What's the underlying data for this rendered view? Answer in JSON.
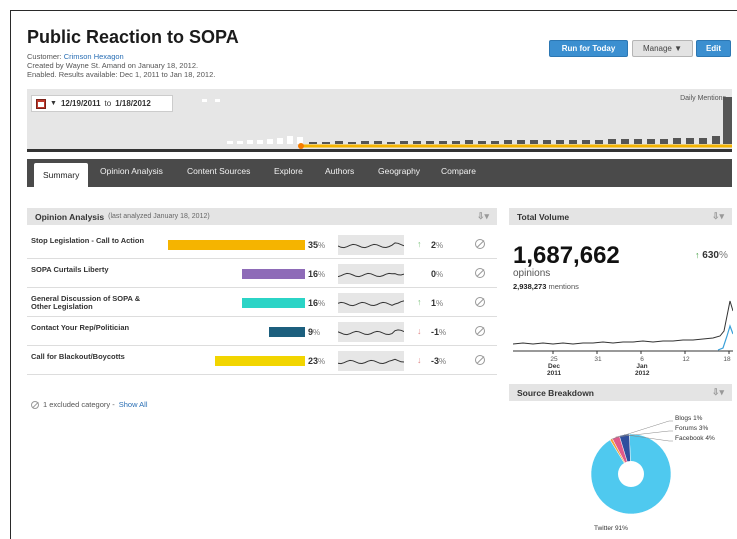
{
  "header": {
    "title": "Public Reaction to SOPA",
    "customer_prefix": "Customer:",
    "customer_name": "Crimson Hexagon",
    "created_line": "Created by Wayne St. Amand on January 18, 2012.",
    "enabled_line": "Enabled. Results available: Dec 1, 2011 to Jan 18, 2012."
  },
  "toolbar": {
    "run_label": "Run for Today",
    "manage_label": "Manage ▼",
    "edit_label": "Edit"
  },
  "timeline": {
    "date_from": "12/19/2011",
    "date_to_word": "to",
    "date_to": "1/18/2012",
    "daily_label": "Daily Mentions",
    "accent_color": "#f5b400"
  },
  "tabs": [
    {
      "label": "Summary"
    },
    {
      "label": "Opinion Analysis"
    },
    {
      "label": "Content Sources"
    },
    {
      "label": "Explore"
    },
    {
      "label": "Authors"
    },
    {
      "label": "Geography"
    },
    {
      "label": "Compare"
    }
  ],
  "opinion_panel": {
    "title": "Opinion Analysis",
    "subtitle": "(last analyzed January 18, 2012)",
    "rows": [
      {
        "label": "Stop Legislation - Call to Action",
        "pct": "35",
        "bar_fraction": 1.0,
        "color": "#f5b400",
        "change": "2",
        "direction": "up",
        "arrow": "↑"
      },
      {
        "label": "SOPA Curtails Liberty",
        "pct": "16",
        "bar_fraction": 0.46,
        "color": "#8e6bb8",
        "change": "0",
        "direction": "none",
        "arrow": ""
      },
      {
        "label": "General Discussion of SOPA & Other Legislation",
        "pct": "16",
        "bar_fraction": 0.46,
        "color": "#2bd4c6",
        "change": "1",
        "direction": "up",
        "arrow": "↑"
      },
      {
        "label": "Contact Your Rep/Politician",
        "pct": "9",
        "bar_fraction": 0.26,
        "color": "#1c5f7e",
        "change": "-1",
        "direction": "down",
        "arrow": "↓"
      },
      {
        "label": "Call for Blackout/Boycotts",
        "pct": "23",
        "bar_fraction": 0.66,
        "color": "#f2d500",
        "change": "-3",
        "direction": "down",
        "arrow": "↓"
      }
    ],
    "percent_unit": "%",
    "excluded_text": "1 excluded category -",
    "show_all_label": "Show All"
  },
  "volume_panel": {
    "title": "Total Volume",
    "total": "1,687,662",
    "opinions_label": "opinions",
    "mentions_value": "2,938,273",
    "mentions_label": "mentions",
    "change": "630",
    "change_arrow": "↑",
    "percent_unit": "%",
    "axis_ticks": [
      {
        "day": "25",
        "month": "Dec",
        "year": "2011"
      },
      {
        "day": "31",
        "month": "",
        "year": ""
      },
      {
        "day": "6",
        "month": "Jan",
        "year": "2012"
      },
      {
        "day": "12",
        "month": "",
        "year": ""
      },
      {
        "day": "18",
        "month": "",
        "year": ""
      }
    ]
  },
  "source_panel": {
    "title": "Source Breakdown",
    "slices": [
      {
        "label": "Twitter 91%",
        "value": 91,
        "color": "#4fc9ef"
      },
      {
        "label": "Blogs 1%",
        "value": 1,
        "color": "#f2a33a"
      },
      {
        "label": "Forums 3%",
        "value": 3,
        "color": "#e05a8a"
      },
      {
        "label": "Facebook 4%",
        "value": 4,
        "color": "#2f4f9e"
      }
    ]
  }
}
